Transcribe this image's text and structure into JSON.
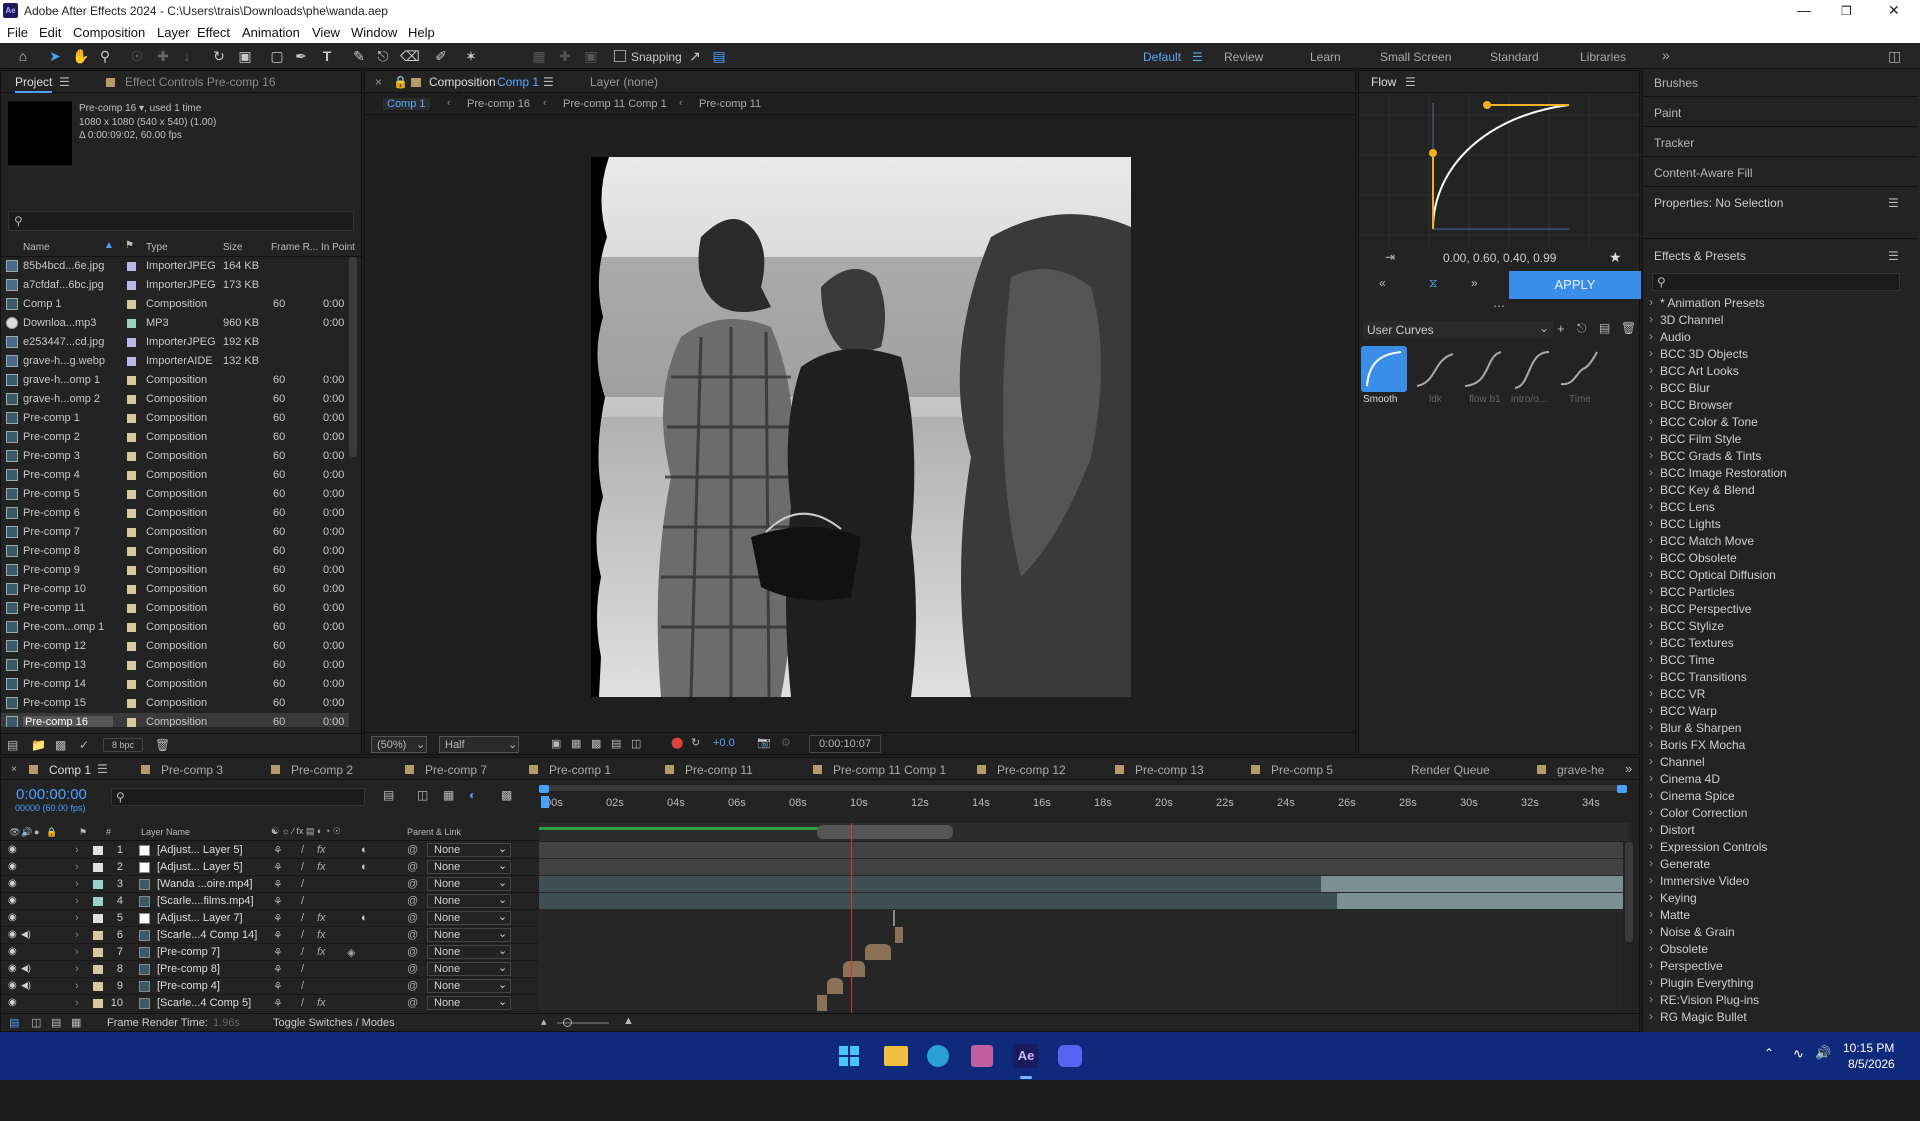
{
  "window": {
    "title": "Adobe After Effects 2024 - C:\\Users\\trais\\Downloads\\phe\\wanda.aep",
    "app_icon": "Ae"
  },
  "menu": [
    "File",
    "Edit",
    "Composition",
    "Layer",
    "Effect",
    "Animation",
    "View",
    "Window",
    "Help"
  ],
  "toolbar": {
    "snapping_label": "Snapping",
    "workspaces": [
      "Default",
      "Review",
      "Learn",
      "Small Screen",
      "Standard",
      "Libraries"
    ],
    "active_workspace": "Default"
  },
  "project_panel": {
    "tabs": [
      "Project",
      "Effect Controls Pre-comp 16"
    ],
    "info_name": "Pre-comp 16",
    "info_used": ", used 1 time",
    "info_dims": "1080 x 1080  (540 x 540) (1.00)",
    "info_dur": "Δ 0:00:09:02, 60.00 fps",
    "columns": [
      "Name",
      "Type",
      "Size",
      "Frame R...",
      "In Point"
    ],
    "items": [
      {
        "name": "85b4bcd...6e.jpg",
        "type": "ImporterJPEG",
        "size": "164 KB",
        "fr": "",
        "inpoint": "",
        "color": "#b8b8e8",
        "kind": "img"
      },
      {
        "name": "a7cfdaf...6bc.jpg",
        "type": "ImporterJPEG",
        "size": "173 KB",
        "fr": "",
        "inpoint": "",
        "color": "#b8b8e8",
        "kind": "img"
      },
      {
        "name": "Comp 1",
        "type": "Composition",
        "size": "",
        "fr": "60",
        "inpoint": "0:00",
        "color": "#d8c8a0",
        "kind": "comp"
      },
      {
        "name": "Downloa...mp3",
        "type": "MP3",
        "size": "960 KB",
        "fr": "",
        "inpoint": "0:00",
        "color": "#9ad0c8",
        "kind": "audio"
      },
      {
        "name": "e253447...cd.jpg",
        "type": "ImporterJPEG",
        "size": "192 KB",
        "fr": "",
        "inpoint": "",
        "color": "#b8b8e8",
        "kind": "img"
      },
      {
        "name": "grave-h...g.webp",
        "type": "ImporterAIDE",
        "size": "132 KB",
        "fr": "",
        "inpoint": "",
        "color": "#b8b8e8",
        "kind": "img"
      },
      {
        "name": "grave-h...omp 1",
        "type": "Composition",
        "size": "",
        "fr": "60",
        "inpoint": "0:00",
        "color": "#d8c8a0",
        "kind": "comp"
      },
      {
        "name": "grave-h...omp 2",
        "type": "Composition",
        "size": "",
        "fr": "60",
        "inpoint": "0:00",
        "color": "#d8c8a0",
        "kind": "comp"
      },
      {
        "name": "Pre-comp 1",
        "type": "Composition",
        "size": "",
        "fr": "60",
        "inpoint": "0:00",
        "color": "#d8c8a0",
        "kind": "comp"
      },
      {
        "name": "Pre-comp 2",
        "type": "Composition",
        "size": "",
        "fr": "60",
        "inpoint": "0:00",
        "color": "#d8c8a0",
        "kind": "comp"
      },
      {
        "name": "Pre-comp 3",
        "type": "Composition",
        "size": "",
        "fr": "60",
        "inpoint": "0:00",
        "color": "#d8c8a0",
        "kind": "comp"
      },
      {
        "name": "Pre-comp 4",
        "type": "Composition",
        "size": "",
        "fr": "60",
        "inpoint": "0:00",
        "color": "#d8c8a0",
        "kind": "comp"
      },
      {
        "name": "Pre-comp 5",
        "type": "Composition",
        "size": "",
        "fr": "60",
        "inpoint": "0:00",
        "color": "#d8c8a0",
        "kind": "comp"
      },
      {
        "name": "Pre-comp 6",
        "type": "Composition",
        "size": "",
        "fr": "60",
        "inpoint": "0:00",
        "color": "#d8c8a0",
        "kind": "comp"
      },
      {
        "name": "Pre-comp 7",
        "type": "Composition",
        "size": "",
        "fr": "60",
        "inpoint": "0:00",
        "color": "#d8c8a0",
        "kind": "comp"
      },
      {
        "name": "Pre-comp 8",
        "type": "Composition",
        "size": "",
        "fr": "60",
        "inpoint": "0:00",
        "color": "#d8c8a0",
        "kind": "comp"
      },
      {
        "name": "Pre-comp 9",
        "type": "Composition",
        "size": "",
        "fr": "60",
        "inpoint": "0:00",
        "color": "#d8c8a0",
        "kind": "comp"
      },
      {
        "name": "Pre-comp 10",
        "type": "Composition",
        "size": "",
        "fr": "60",
        "inpoint": "0:00",
        "color": "#d8c8a0",
        "kind": "comp"
      },
      {
        "name": "Pre-comp 11",
        "type": "Composition",
        "size": "",
        "fr": "60",
        "inpoint": "0:00",
        "color": "#d8c8a0",
        "kind": "comp"
      },
      {
        "name": "Pre-com...omp 1",
        "type": "Composition",
        "size": "",
        "fr": "60",
        "inpoint": "0:00",
        "color": "#d8c8a0",
        "kind": "comp"
      },
      {
        "name": "Pre-comp 12",
        "type": "Composition",
        "size": "",
        "fr": "60",
        "inpoint": "0:00",
        "color": "#d8c8a0",
        "kind": "comp"
      },
      {
        "name": "Pre-comp 13",
        "type": "Composition",
        "size": "",
        "fr": "60",
        "inpoint": "0:00",
        "color": "#d8c8a0",
        "kind": "comp"
      },
      {
        "name": "Pre-comp 14",
        "type": "Composition",
        "size": "",
        "fr": "60",
        "inpoint": "0:00",
        "color": "#d8c8a0",
        "kind": "comp"
      },
      {
        "name": "Pre-comp 15",
        "type": "Composition",
        "size": "",
        "fr": "60",
        "inpoint": "0:00",
        "color": "#d8c8a0",
        "kind": "comp"
      },
      {
        "name": "Pre-comp 16",
        "type": "Composition",
        "size": "",
        "fr": "60",
        "inpoint": "0:00",
        "color": "#d8c8a0",
        "kind": "comp",
        "selected": true
      }
    ],
    "bpc": "8 bpc"
  },
  "comp_panel": {
    "tab_title": "Composition",
    "tab_comp": "Comp 1",
    "layer_tab": "Layer (none)",
    "breadcrumbs": [
      "Comp 1",
      "Pre-comp 16",
      "Pre-comp 11 Comp 1",
      "Pre-comp 11"
    ],
    "zoom": "(50%)",
    "resolution": "Half",
    "exposure": "+0.0",
    "timecode": "0:00:10:07"
  },
  "flow_panel": {
    "title": "Flow",
    "values": "0.00, 0.60, 0.40, 0.99",
    "apply": "APPLY",
    "curves_menu": "User Curves",
    "presets": [
      "Smooth",
      "ldk",
      "flow b1",
      "intro/o...",
      "Time"
    ]
  },
  "right_rail": {
    "items": [
      "Brushes",
      "Paint",
      "Tracker",
      "Content-Aware Fill"
    ],
    "properties": "Properties: No Selection",
    "effects_title": "Effects & Presets",
    "effects": [
      "* Animation Presets",
      "3D Channel",
      "Audio",
      "BCC 3D Objects",
      "BCC Art Looks",
      "BCC Blur",
      "BCC Browser",
      "BCC Color & Tone",
      "BCC Film Style",
      "BCC Grads & Tints",
      "BCC Image Restoration",
      "BCC Key & Blend",
      "BCC Lens",
      "BCC Lights",
      "BCC Match Move",
      "BCC Obsolete",
      "BCC Optical Diffusion",
      "BCC Particles",
      "BCC Perspective",
      "BCC Stylize",
      "BCC Textures",
      "BCC Time",
      "BCC Transitions",
      "BCC VR",
      "BCC Warp",
      "Blur & Sharpen",
      "Boris FX Mocha",
      "Channel",
      "Cinema 4D",
      "Cinema Spice",
      "Color Correction",
      "Distort",
      "Expression Controls",
      "Generate",
      "Immersive Video",
      "Keying",
      "Matte",
      "Noise & Grain",
      "Obsolete",
      "Perspective",
      "Plugin Everything",
      "RE:Vision Plug-ins",
      "RG Magic Bullet"
    ]
  },
  "timeline": {
    "tabs": [
      "Comp 1",
      "Pre-comp 3",
      "Pre-comp 2",
      "Pre-comp 7",
      "Pre-comp 1",
      "Pre-comp 11",
      "Pre-comp 11 Comp 1",
      "Pre-comp 12",
      "Pre-comp 13",
      "Pre-comp 5",
      "Render Queue",
      "grave-hе"
    ],
    "current_time": "0:00:00:00",
    "fps": "00000 (60.00 fps)",
    "col_layer": "Layer Name",
    "col_parent": "Parent & Link",
    "ruler": [
      "00s",
      "02s",
      "04s",
      "06s",
      "08s",
      "10s",
      "12s",
      "14s",
      "16s",
      "18s",
      "20s",
      "22s",
      "24s",
      "26s",
      "28s",
      "30s",
      "32s",
      "34s"
    ],
    "layers": [
      {
        "num": "1",
        "name": "[Adjust... Layer 5]",
        "color": "#e0e0e0",
        "parent": "None",
        "fx": true
      },
      {
        "num": "2",
        "name": "[Adjust... Layer 5]",
        "color": "#e0e0e0",
        "parent": "None",
        "fx": true
      },
      {
        "num": "3",
        "name": "[Wanda ...oire.mp4]",
        "color": "#9ad0c8",
        "parent": "None",
        "fx": false
      },
      {
        "num": "4",
        "name": "[Scarle....films.mp4]",
        "color": "#9ad0c8",
        "parent": "None",
        "fx": false
      },
      {
        "num": "5",
        "name": "[Adjust... Layer 7]",
        "color": "#e0e0e0",
        "parent": "None",
        "fx": true
      },
      {
        "num": "6",
        "name": "[Scarle...4 Comp 14]",
        "color": "#d8c8a0",
        "parent": "None",
        "fx": true
      },
      {
        "num": "7",
        "name": "[Pre-comp 7]",
        "color": "#d8c8a0",
        "parent": "None",
        "fx": true
      },
      {
        "num": "8",
        "name": "[Pre-comp 8]",
        "color": "#d8c8a0",
        "parent": "None",
        "fx": false
      },
      {
        "num": "9",
        "name": "[Pre-comp 4]",
        "color": "#d8c8a0",
        "parent": "None",
        "fx": false
      },
      {
        "num": "10",
        "name": "[Scarle...4 Comp 5]",
        "color": "#d8c8a0",
        "parent": "None",
        "fx": true
      }
    ],
    "footer_render": "Frame Render Time:",
    "footer_render_val": "1.96s",
    "footer_toggle": "Toggle Switches / Modes"
  },
  "taskbar": {
    "time": "10:15 PM",
    "date": "8/5/2026"
  }
}
